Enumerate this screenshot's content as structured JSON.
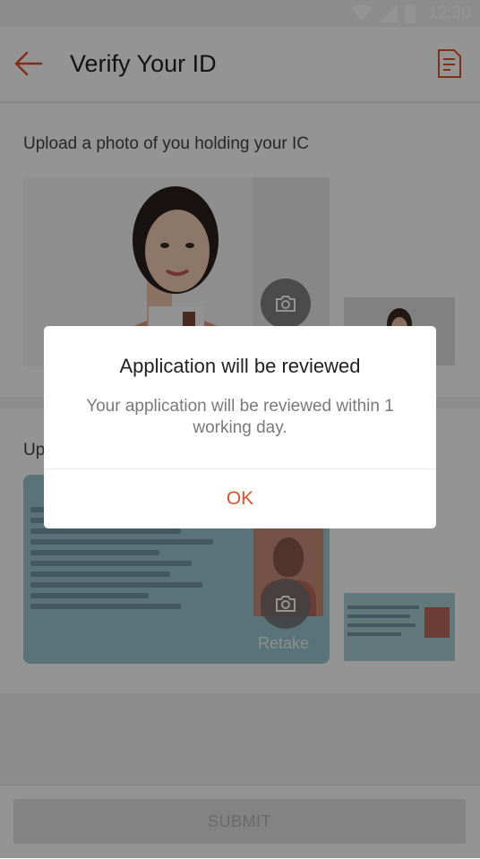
{
  "status_bar": {
    "time": "12:30"
  },
  "header": {
    "title": "Verify Your ID"
  },
  "selfie_section": {
    "title": "Upload a photo of you holding your IC"
  },
  "ic_section": {
    "title_visible": "Up",
    "retake_label": "Retake"
  },
  "footer": {
    "submit_label": "SUBMIT"
  },
  "dialog": {
    "title": "Application will be reviewed",
    "message": "Your application will be reviewed within 1 working day.",
    "ok_label": "OK"
  },
  "colors": {
    "accent": "#e0522a",
    "scrim": "rgba(0,0,0,0.42)"
  },
  "icons": [
    "wifi-icon",
    "signal-icon",
    "battery-icon",
    "back-arrow-icon",
    "document-icon",
    "camera-icon"
  ]
}
